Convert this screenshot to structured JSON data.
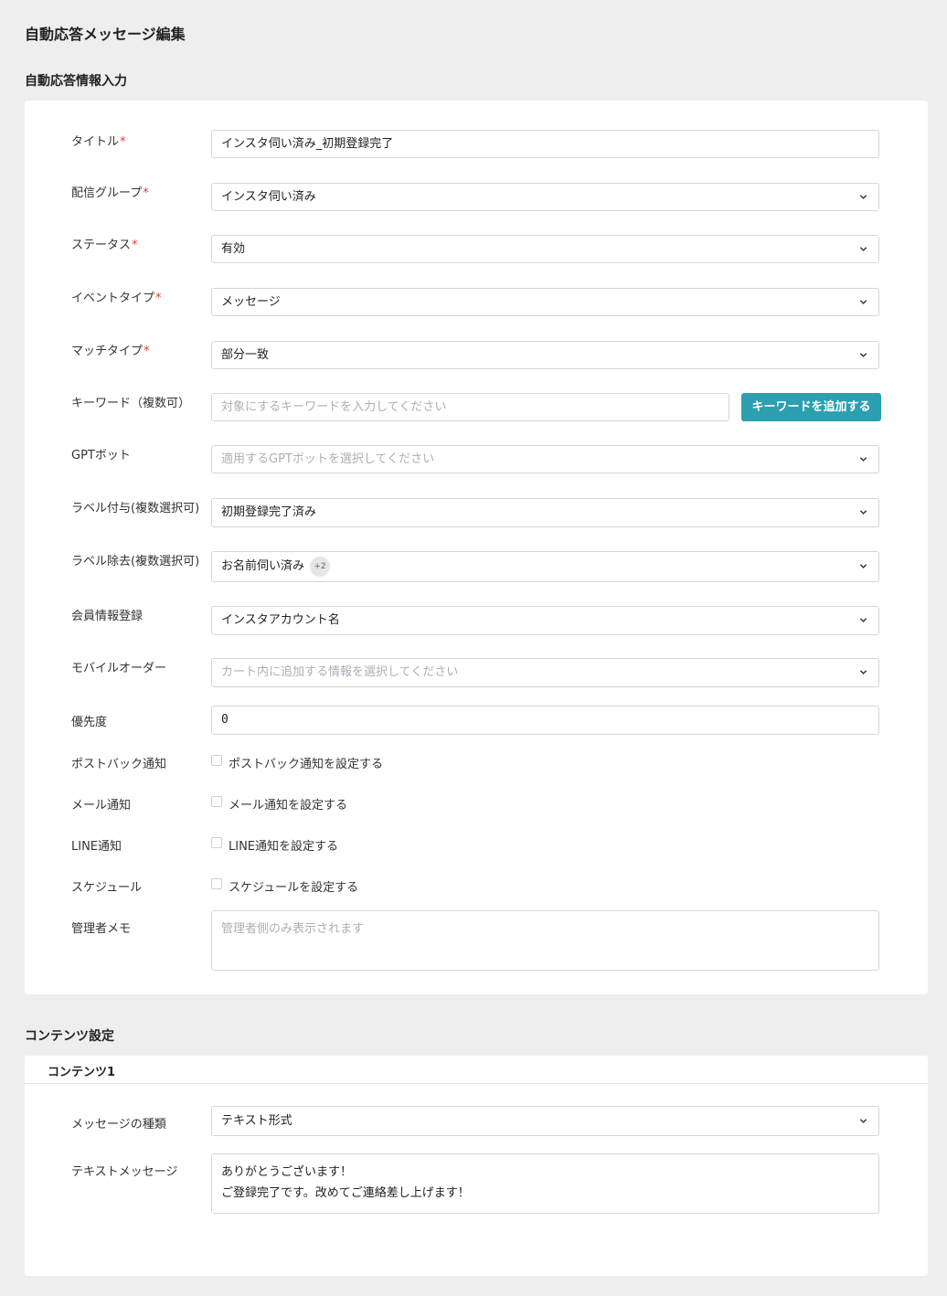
{
  "page": {
    "title": "自動応答メッセージ編集"
  },
  "info_section": {
    "title": "自動応答情報入力",
    "title_field": {
      "label": "タイトル",
      "value": "インスタ伺い済み_初期登録完了"
    },
    "delivery_group": {
      "label": "配信グループ",
      "value": "インスタ伺い済み"
    },
    "status": {
      "label": "ステータス",
      "value": "有効"
    },
    "event_type": {
      "label": "イベントタイプ",
      "value": "メッセージ"
    },
    "match_type": {
      "label": "マッチタイプ",
      "value": "部分一致"
    },
    "keyword": {
      "label": "キーワード（複数可）",
      "placeholder": "対象にするキーワードを入力してください",
      "add_button": "キーワードを追加する"
    },
    "gpt_bot": {
      "label": "GPTボット",
      "placeholder": "適用するGPTボットを選択してください"
    },
    "label_add": {
      "label": "ラベル付与(複数選択可)",
      "value": "初期登録完了済み"
    },
    "label_remove": {
      "label": "ラベル除去(複数選択可)",
      "value": "お名前伺い済み",
      "badge": "+2"
    },
    "member_info": {
      "label": "会員情報登録",
      "value": "インスタアカウント名"
    },
    "mobile_order": {
      "label": "モバイルオーダー",
      "placeholder": "カート内に追加する情報を選択してください"
    },
    "priority": {
      "label": "優先度",
      "value": "0"
    },
    "postback": {
      "label": "ポストバック通知",
      "checkbox_label": "ポストバック通知を設定する",
      "checked": false
    },
    "mail": {
      "label": "メール通知",
      "checkbox_label": "メール通知を設定する",
      "checked": false
    },
    "line": {
      "label": "LINE通知",
      "checkbox_label": "LINE通知を設定する",
      "checked": false
    },
    "schedule": {
      "label": "スケジュール",
      "checkbox_label": "スケジュールを設定する",
      "checked": false
    },
    "memo": {
      "label": "管理者メモ",
      "placeholder": "管理者側のみ表示されます"
    }
  },
  "content_section": {
    "title": "コンテンツ設定",
    "content1": {
      "header": "コンテンツ1",
      "message_type": {
        "label": "メッセージの種類",
        "value": "テキスト形式"
      },
      "text_message": {
        "label": "テキストメッセージ",
        "line1": "ありがとうございます！",
        "line2": "ご登録完了です。改めてご連絡差し上げます！"
      }
    }
  },
  "colors": {
    "accent": "#2c9fb0",
    "required": "#e0393e",
    "background": "#eeeeee"
  },
  "icons": {
    "select": "chevron-down-icon"
  }
}
